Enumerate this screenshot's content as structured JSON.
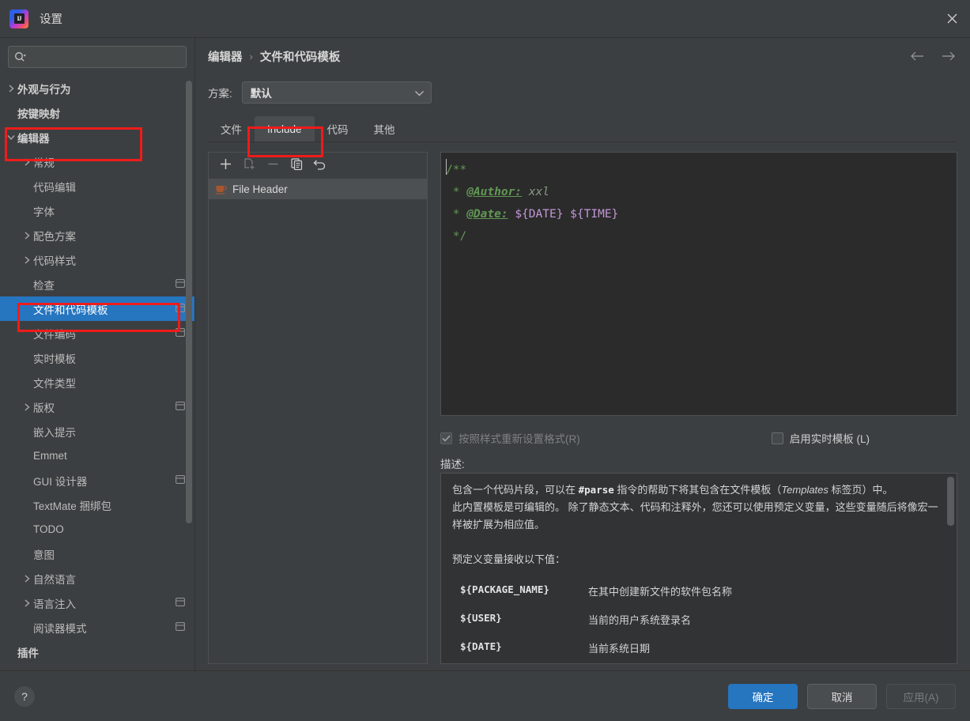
{
  "window": {
    "title": "设置",
    "logo_letters": "IJ",
    "close_icon": "close-icon"
  },
  "sidebar": {
    "search": {
      "value": "",
      "placeholder": ""
    },
    "items": [
      {
        "label": "外观与行为",
        "level": 0,
        "arrow": "collapsed",
        "bold": true,
        "project_icon": false,
        "selected": false
      },
      {
        "label": "按键映射",
        "level": 0,
        "arrow": "none",
        "bold": true,
        "project_icon": false,
        "selected": false
      },
      {
        "label": "编辑器",
        "level": 0,
        "arrow": "expanded",
        "bold": true,
        "project_icon": false,
        "selected": false
      },
      {
        "label": "常规",
        "level": 1,
        "arrow": "collapsed",
        "bold": false,
        "project_icon": false,
        "selected": false
      },
      {
        "label": "代码编辑",
        "level": 1,
        "arrow": "none",
        "bold": false,
        "project_icon": false,
        "selected": false
      },
      {
        "label": "字体",
        "level": 1,
        "arrow": "none",
        "bold": false,
        "project_icon": false,
        "selected": false
      },
      {
        "label": "配色方案",
        "level": 1,
        "arrow": "collapsed",
        "bold": false,
        "project_icon": false,
        "selected": false
      },
      {
        "label": "代码样式",
        "level": 1,
        "arrow": "collapsed",
        "bold": false,
        "project_icon": false,
        "selected": false
      },
      {
        "label": "检查",
        "level": 1,
        "arrow": "none",
        "bold": false,
        "project_icon": true,
        "selected": false
      },
      {
        "label": "文件和代码模板",
        "level": 1,
        "arrow": "none",
        "bold": false,
        "project_icon": true,
        "selected": true
      },
      {
        "label": "文件编码",
        "level": 1,
        "arrow": "none",
        "bold": false,
        "project_icon": true,
        "selected": false
      },
      {
        "label": "实时模板",
        "level": 1,
        "arrow": "none",
        "bold": false,
        "project_icon": false,
        "selected": false
      },
      {
        "label": "文件类型",
        "level": 1,
        "arrow": "none",
        "bold": false,
        "project_icon": false,
        "selected": false
      },
      {
        "label": "版权",
        "level": 1,
        "arrow": "collapsed",
        "bold": false,
        "project_icon": true,
        "selected": false
      },
      {
        "label": "嵌入提示",
        "level": 1,
        "arrow": "none",
        "bold": false,
        "project_icon": false,
        "selected": false
      },
      {
        "label": "Emmet",
        "level": 1,
        "arrow": "none",
        "bold": false,
        "project_icon": false,
        "selected": false
      },
      {
        "label": "GUI 设计器",
        "level": 1,
        "arrow": "none",
        "bold": false,
        "project_icon": true,
        "selected": false
      },
      {
        "label": "TextMate 捆绑包",
        "level": 1,
        "arrow": "none",
        "bold": false,
        "project_icon": false,
        "selected": false
      },
      {
        "label": "TODO",
        "level": 1,
        "arrow": "none",
        "bold": false,
        "project_icon": false,
        "selected": false
      },
      {
        "label": "意图",
        "level": 1,
        "arrow": "none",
        "bold": false,
        "project_icon": false,
        "selected": false
      },
      {
        "label": "自然语言",
        "level": 1,
        "arrow": "collapsed",
        "bold": false,
        "project_icon": false,
        "selected": false
      },
      {
        "label": "语言注入",
        "level": 1,
        "arrow": "collapsed",
        "bold": false,
        "project_icon": true,
        "selected": false
      },
      {
        "label": "阅读器模式",
        "level": 1,
        "arrow": "none",
        "bold": false,
        "project_icon": true,
        "selected": false
      },
      {
        "label": "插件",
        "level": 0,
        "arrow": "none",
        "bold": true,
        "project_icon": false,
        "selected": false
      }
    ]
  },
  "header": {
    "breadcrumb": [
      "编辑器",
      "文件和代码模板"
    ],
    "separator": "›",
    "back_icon": "arrow-left-icon",
    "forward_icon": "arrow-right-icon"
  },
  "scheme": {
    "label": "方案:",
    "value": "默认",
    "chevron_icon": "chevron-down-icon"
  },
  "tabs": [
    {
      "label": "文件",
      "active": false
    },
    {
      "label": "Include",
      "active": true
    },
    {
      "label": "代码",
      "active": false
    },
    {
      "label": "其他",
      "active": false
    }
  ],
  "templates": {
    "toolbar": [
      {
        "name": "add-template-button",
        "icon": "plus-icon",
        "disabled": false
      },
      {
        "name": "add-child-template-button",
        "icon": "add-child-icon",
        "disabled": true
      },
      {
        "name": "remove-template-button",
        "icon": "minus-icon",
        "disabled": true
      },
      {
        "name": "copy-template-button",
        "icon": "copy-icon",
        "disabled": false
      },
      {
        "name": "reset-template-button",
        "icon": "revert-icon",
        "disabled": false
      }
    ],
    "items": [
      {
        "label": "File Header",
        "icon": "java-coffee-cup-icon",
        "selected": true
      }
    ]
  },
  "editor": {
    "lines": [
      [
        {
          "t": "/**",
          "s": "comment"
        }
      ],
      [
        {
          "t": " * ",
          "s": "comment"
        },
        {
          "t": "@Author:",
          "s": "tag"
        },
        {
          "t": " xxl",
          "s": "text"
        }
      ],
      [
        {
          "t": " * ",
          "s": "comment"
        },
        {
          "t": "@Date:",
          "s": "tag"
        },
        {
          "t": " ",
          "s": "comment"
        },
        {
          "t": "${DATE} ${TIME}",
          "s": "var"
        }
      ],
      [
        {
          "t": " */",
          "s": "comment"
        }
      ]
    ]
  },
  "options": {
    "reformat": {
      "label": "按照样式重新设置格式(R)",
      "checked": true,
      "disabled": true
    },
    "live_template": {
      "label": "启用实时模板 (L)",
      "checked": false,
      "disabled": false
    }
  },
  "description": {
    "label": "描述:",
    "paragraph_1_pre": "包含一个代码片段，可以在 ",
    "paragraph_1_mono": "#parse",
    "paragraph_1_mid": " 指令的帮助下将其包含在文件模板（",
    "paragraph_1_italic": "Templates",
    "paragraph_1_post": " 标签页）中。",
    "paragraph_2": "此内置模板是可编辑的。 除了静态文本、代码和注释外，您还可以使用预定义变量，这些变量随后将像宏一样被扩展为相应值。",
    "subtitle": "预定义变量接收以下值：",
    "variables": [
      {
        "name": "${PACKAGE_NAME}",
        "desc": "在其中创建新文件的软件包名称"
      },
      {
        "name": "${USER}",
        "desc": "当前的用户系统登录名"
      },
      {
        "name": "${DATE}",
        "desc": "当前系统日期"
      }
    ]
  },
  "footer": {
    "help_label": "?",
    "ok_label": "确定",
    "cancel_label": "取消",
    "apply_label": "应用(A)"
  },
  "colors": {
    "accent_blue": "#2675bf",
    "annotation_red": "#f01b1b",
    "panel_bg": "#3c3f41",
    "editor_bg": "#2b2b2b",
    "desc_bg": "#313335"
  }
}
